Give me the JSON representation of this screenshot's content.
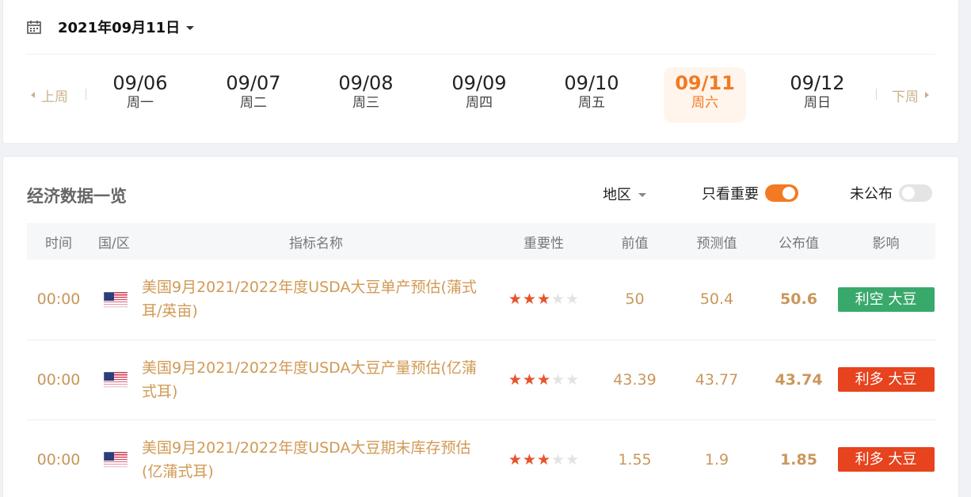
{
  "date_picker": {
    "selected_date": "2021年09月11日"
  },
  "week_nav": {
    "prev_label": "上周",
    "next_label": "下周"
  },
  "days": [
    {
      "date": "09/06",
      "weekday": "周一",
      "active": false
    },
    {
      "date": "09/07",
      "weekday": "周二",
      "active": false
    },
    {
      "date": "09/08",
      "weekday": "周三",
      "active": false
    },
    {
      "date": "09/09",
      "weekday": "周四",
      "active": false
    },
    {
      "date": "09/10",
      "weekday": "周五",
      "active": false
    },
    {
      "date": "09/11",
      "weekday": "周六",
      "active": true
    },
    {
      "date": "09/12",
      "weekday": "周日",
      "active": false
    }
  ],
  "section": {
    "title": "经济数据一览",
    "region_label": "地区",
    "important_only_label": "只看重要",
    "important_only_on": true,
    "unpublished_label": "未公布",
    "unpublished_on": false
  },
  "table": {
    "headers": [
      "时间",
      "国/区",
      "指标名称",
      "重要性",
      "前值",
      "预测值",
      "公布值",
      "影响"
    ],
    "rows": [
      {
        "time": "00:00",
        "country": "us-flag-icon",
        "name": "美国9月2021/2022年度USDA大豆单产预估(蒲式耳/英亩)",
        "stars": 3,
        "prev": "50",
        "forecast": "50.4",
        "actual": "50.6",
        "impact": "利空 大豆",
        "impact_type": "bearish"
      },
      {
        "time": "00:00",
        "country": "us-flag-icon",
        "name": "美国9月2021/2022年度USDA大豆产量预估(亿蒲式耳)",
        "stars": 3,
        "prev": "43.39",
        "forecast": "43.77",
        "actual": "43.74",
        "impact": "利多 大豆",
        "impact_type": "bullish"
      },
      {
        "time": "00:00",
        "country": "us-flag-icon",
        "name": "美国9月2021/2022年度USDA大豆期末库存预估(亿蒲式耳)",
        "stars": 3,
        "prev": "1.55",
        "forecast": "1.9",
        "actual": "1.85",
        "impact": "利多 大豆",
        "impact_type": "bullish"
      }
    ]
  },
  "colors": {
    "accent": "#f37a22",
    "bearish": "#39a96b",
    "bullish": "#e6431e",
    "muted_gold": "#c9975a"
  }
}
